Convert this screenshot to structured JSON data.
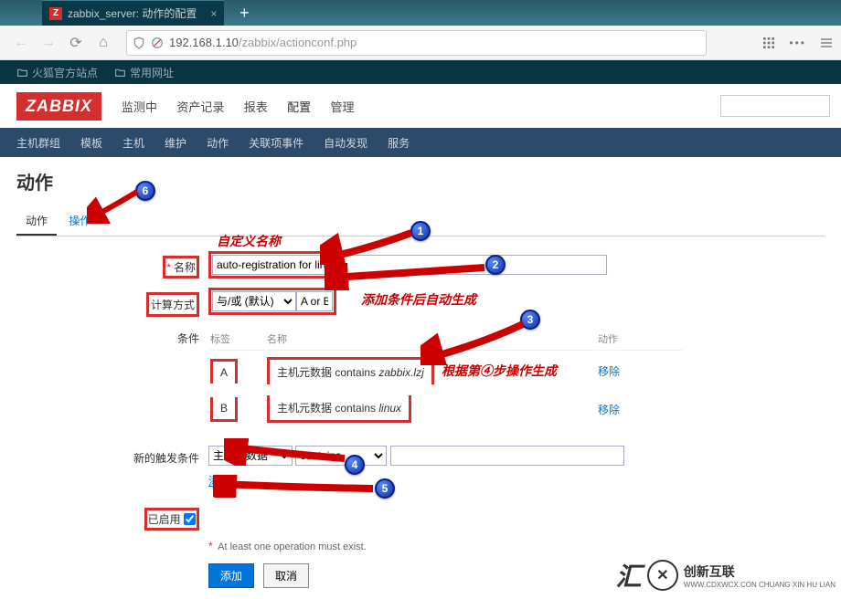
{
  "browser": {
    "tab_title": "zabbix_server: 动作的配置",
    "tab_close": "×",
    "newtab": "+",
    "url_host": "192.168.1.10",
    "url_path": "/zabbix/actionconf.php",
    "bookmarks": [
      "火狐官方站点",
      "常用网址"
    ],
    "nav_icons": {
      "back": "←",
      "forward": "→",
      "reload": "⟳",
      "home": "⌂"
    },
    "menu_dots": "•••"
  },
  "zabbix": {
    "logo": "ZABBIX",
    "top_nav": [
      "监测中",
      "资产记录",
      "报表",
      "配置",
      "管理"
    ],
    "top_nav_active": "配置",
    "sub_nav": [
      "主机群组",
      "模板",
      "主机",
      "维护",
      "动作",
      "关联项事件",
      "自动发现",
      "服务"
    ],
    "sub_nav_active": "动作",
    "page_title": "动作",
    "tabs": [
      "动作",
      "操作"
    ],
    "tabs_active": "动作",
    "form": {
      "name_label": "名称",
      "name_value": "auto-registration for linux",
      "calc_label": "计算方式",
      "calc_value": "与/或 (默认)",
      "calc_formula": "A or B",
      "cond_label": "条件",
      "cond_headers": {
        "tag": "标签",
        "name": "名称",
        "action": "动作"
      },
      "conditions": [
        {
          "tag": "A",
          "text": "主机元数据 contains ",
          "val": "zabbix.lzj",
          "action": "移除"
        },
        {
          "tag": "B",
          "text": "主机元数据 contains ",
          "val": "linux",
          "action": "移除"
        }
      ],
      "newcond_label": "新的触发条件",
      "newcond_type": "主机元数据",
      "newcond_op": "contains",
      "newcond_val": "",
      "add_link": "添加",
      "enabled_label": "已启用",
      "footnote": "At least one operation must exist.",
      "submit": "添加",
      "cancel": "取消"
    }
  },
  "annotations": {
    "a1": "自定义名称",
    "a2": "添加条件后自动生成",
    "a3": "根据第④步操作生成"
  },
  "watermark": {
    "text": "创新互联",
    "url": "WWW.CDXWCX.CON CHUANG XIN HU LIAN"
  }
}
